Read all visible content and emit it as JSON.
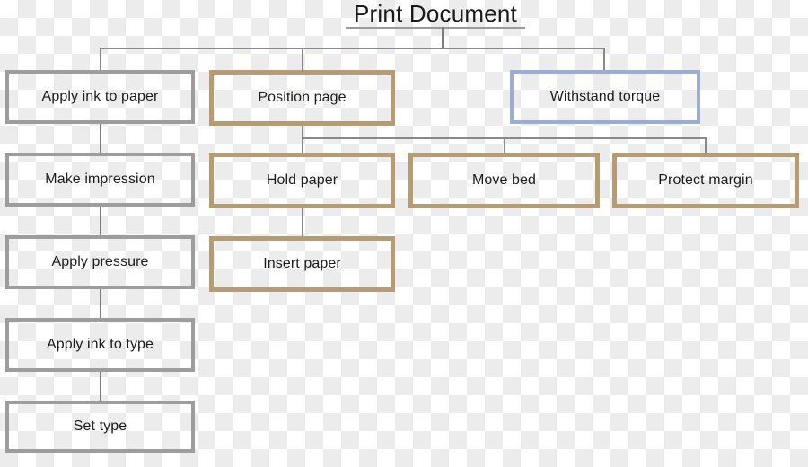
{
  "diagram": {
    "title": "Print Document",
    "type": "hierarchical-tree-diagram",
    "colors": {
      "gray_border": "#9d9d9d",
      "tan_border": "#b79b72",
      "blue_border": "#9aaed2",
      "connector": "#8a8a8a",
      "text": "#1c1c1c"
    },
    "branches": [
      {
        "id": "branch-apply-ink-to-paper",
        "style": "gray",
        "nodes": [
          {
            "id": "node-apply-ink-to-paper",
            "label": "Apply ink to paper",
            "style": "gray"
          },
          {
            "id": "node-make-impression",
            "label": "Make impression",
            "style": "gray"
          },
          {
            "id": "node-apply-pressure",
            "label": "Apply pressure",
            "style": "gray"
          },
          {
            "id": "node-apply-ink-to-type",
            "label": "Apply ink to type",
            "style": "gray"
          },
          {
            "id": "node-set-type",
            "label": "Set type",
            "style": "gray"
          }
        ]
      },
      {
        "id": "branch-position-page",
        "style": "tan",
        "nodes": [
          {
            "id": "node-position-page",
            "label": "Position page",
            "style": "tan"
          },
          {
            "id": "node-hold-paper",
            "label": "Hold paper",
            "style": "tan"
          },
          {
            "id": "node-insert-paper",
            "label": "Insert paper",
            "style": "tan"
          },
          {
            "id": "node-move-bed",
            "label": "Move bed",
            "style": "tan"
          },
          {
            "id": "node-protect-margin",
            "label": "Protect margin",
            "style": "tan"
          }
        ]
      },
      {
        "id": "branch-withstand-torque",
        "style": "blue",
        "nodes": [
          {
            "id": "node-withstand-torque",
            "label": "Withstand torque",
            "style": "blue"
          }
        ]
      }
    ],
    "nodes": {
      "apply_ink_to_paper": "Apply ink to paper",
      "position_page": "Position page",
      "withstand_torque": "Withstand torque",
      "make_impression": "Make impression",
      "hold_paper": "Hold paper",
      "move_bed": "Move bed",
      "protect_margin": "Protect margin",
      "apply_pressure": "Apply pressure",
      "insert_paper": "Insert paper",
      "apply_ink_to_type": "Apply ink to type",
      "set_type": "Set type"
    }
  }
}
